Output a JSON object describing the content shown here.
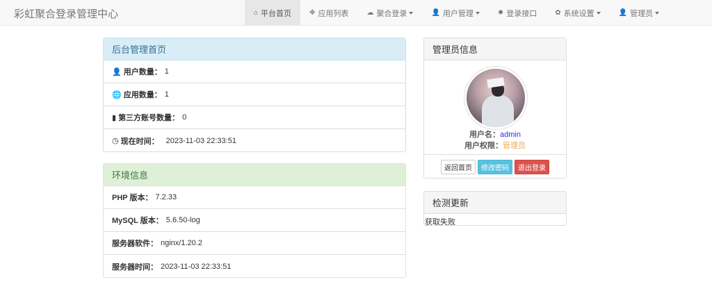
{
  "navbar": {
    "brand": "彩虹聚合登录管理中心",
    "items": [
      {
        "label": "平台首页",
        "icon": "home-icon",
        "glyph": "⌂",
        "active": true,
        "dropdown": false
      },
      {
        "label": "应用列表",
        "icon": "cubes-icon",
        "glyph": "✥",
        "active": false,
        "dropdown": false
      },
      {
        "label": "聚合登录",
        "icon": "cloud-icon",
        "glyph": "☁",
        "active": false,
        "dropdown": true
      },
      {
        "label": "用户管理",
        "icon": "user-icon",
        "glyph": "👤",
        "active": false,
        "dropdown": true
      },
      {
        "label": "登录接口",
        "icon": "gear-icon",
        "glyph": "✹",
        "active": false,
        "dropdown": false
      },
      {
        "label": "系统设置",
        "icon": "cog-icon",
        "glyph": "✿",
        "active": false,
        "dropdown": true
      },
      {
        "label": "管理员",
        "icon": "user-icon",
        "glyph": "👤",
        "active": false,
        "dropdown": true
      }
    ]
  },
  "stats_panel": {
    "title": "后台管理首页",
    "rows": [
      {
        "label": "用户数量：",
        "value": "1",
        "icon": "user-icon"
      },
      {
        "label": "应用数量：",
        "value": "1",
        "icon": "globe-icon"
      },
      {
        "label": "第三方账号数量：",
        "value": "0",
        "icon": "bar-chart-icon"
      },
      {
        "label": "现在时间：",
        "value": "2023-11-03 22:33:51",
        "icon": "clock-icon"
      }
    ]
  },
  "env_panel": {
    "title": "环境信息",
    "rows": [
      {
        "label": "PHP 版本：",
        "value": "7.2.33"
      },
      {
        "label": "MySQL 版本：",
        "value": "5.6.50-log"
      },
      {
        "label": "服务器软件：",
        "value": "nginx/1.20.2"
      },
      {
        "label": "服务器时间：",
        "value": "2023-11-03 22:33:51"
      }
    ]
  },
  "admin_panel": {
    "title": "管理员信息",
    "username_label": "用户名：",
    "username": "admin",
    "role_label": "用户权限：",
    "role": "管理员",
    "buttons": {
      "home": "返回首页",
      "password": "修改密码",
      "logout": "退出登录"
    }
  },
  "update_panel": {
    "title": "检测更新",
    "status": "获取失败"
  },
  "colors": {
    "info_heading": "#d9edf7",
    "success_heading": "#dff0d8",
    "danger": "#d9534f",
    "info_button": "#5bc0de",
    "role_text": "#f0ad4e"
  }
}
